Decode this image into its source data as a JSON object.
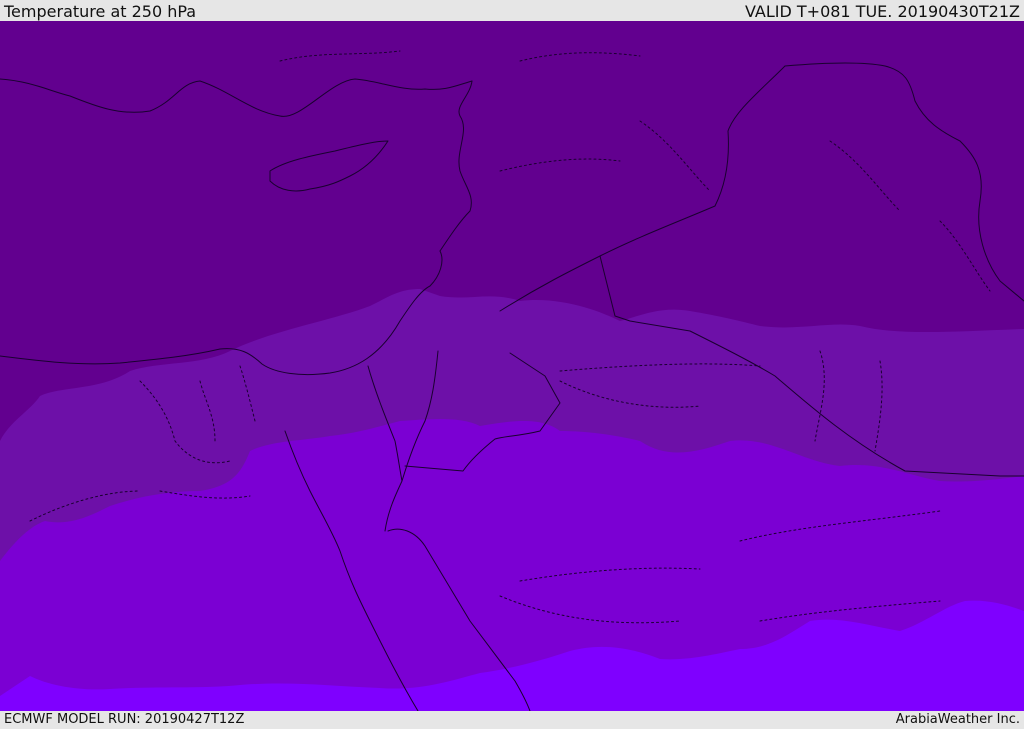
{
  "header": {
    "title": "Temperature at 250 hPa",
    "valid_time": "VALID T+081 TUE. 20190430T21Z"
  },
  "footer": {
    "model_run": "ECMWF MODEL RUN: 20190427T12Z",
    "credit": "ArabiaWeather Inc."
  },
  "map": {
    "field": "temperature-250hpa",
    "bands": [
      {
        "name": "coldest-band",
        "color": "#62008f"
      },
      {
        "name": "cold-band",
        "color": "#6d10a8"
      },
      {
        "name": "mid-band",
        "color": "#7b00d3"
      },
      {
        "name": "warm-band",
        "color": "#7f00ff"
      }
    ],
    "line_color": "#1a0030"
  }
}
